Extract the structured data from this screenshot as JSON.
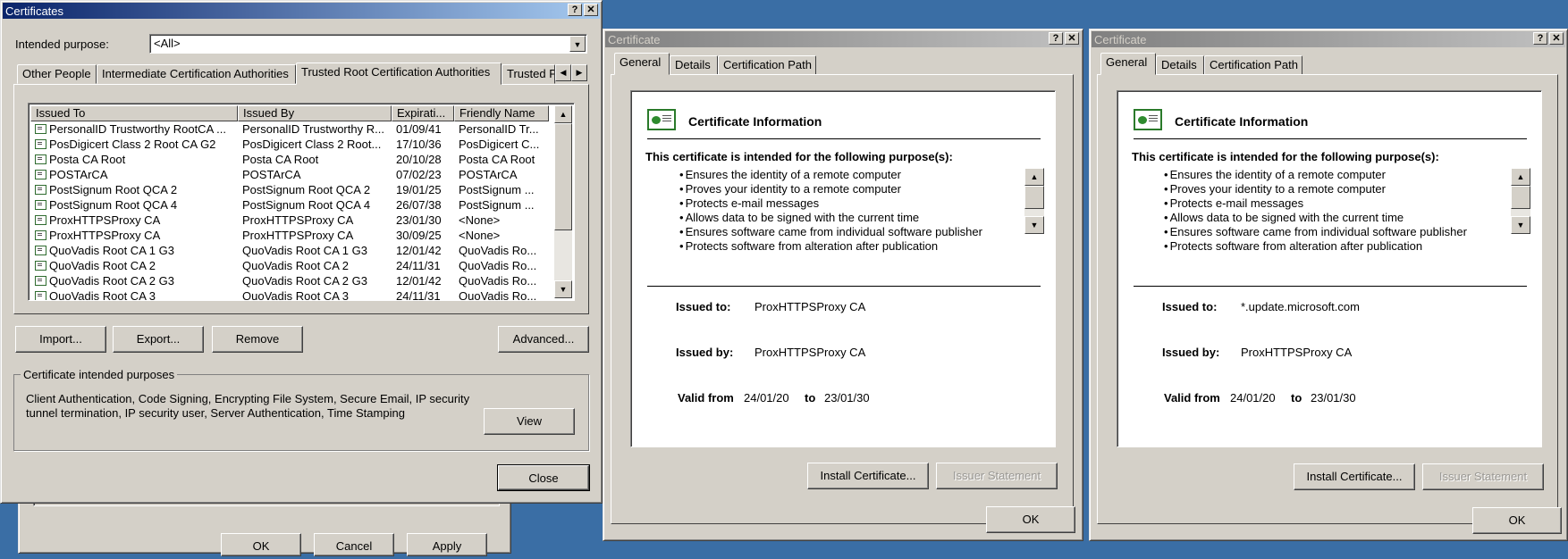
{
  "certificates_window": {
    "title": "Certificates",
    "help_btn": "?",
    "close_btn": "✕",
    "intended_purpose_label": "Intended purpose:",
    "intended_purpose_value": "<All>",
    "tabs": [
      "Other People",
      "Intermediate Certification Authorities",
      "Trusted Root Certification Authorities",
      "Trusted P"
    ],
    "columns": [
      "Issued To",
      "Issued By",
      "Expirati...",
      "Friendly Name"
    ],
    "rows": [
      {
        "to": "PersonalID Trustworthy RootCA ...",
        "by": "PersonalID Trustworthy R...",
        "exp": "01/09/41",
        "name": "PersonalID Tr..."
      },
      {
        "to": "PosDigicert Class 2 Root CA G2",
        "by": "PosDigicert Class 2 Root...",
        "exp": "17/10/36",
        "name": "PosDigicert C..."
      },
      {
        "to": "Posta CA Root",
        "by": "Posta CA Root",
        "exp": "20/10/28",
        "name": "Posta CA Root"
      },
      {
        "to": "POSTArCA",
        "by": "POSTArCA",
        "exp": "07/02/23",
        "name": "POSTArCA"
      },
      {
        "to": "PostSignum Root QCA 2",
        "by": "PostSignum Root QCA 2",
        "exp": "19/01/25",
        "name": "PostSignum ..."
      },
      {
        "to": "PostSignum Root QCA 4",
        "by": "PostSignum Root QCA 4",
        "exp": "26/07/38",
        "name": "PostSignum ..."
      },
      {
        "to": "ProxHTTPSProxy CA",
        "by": "ProxHTTPSProxy CA",
        "exp": "23/01/30",
        "name": "<None>"
      },
      {
        "to": "ProxHTTPSProxy CA",
        "by": "ProxHTTPSProxy CA",
        "exp": "30/09/25",
        "name": "<None>"
      },
      {
        "to": "QuoVadis Root CA 1 G3",
        "by": "QuoVadis Root CA 1 G3",
        "exp": "12/01/42",
        "name": "QuoVadis Ro..."
      },
      {
        "to": "QuoVadis Root CA 2",
        "by": "QuoVadis Root CA 2",
        "exp": "24/11/31",
        "name": "QuoVadis Ro..."
      },
      {
        "to": "QuoVadis Root CA 2 G3",
        "by": "QuoVadis Root CA 2 G3",
        "exp": "12/01/42",
        "name": "QuoVadis Ro..."
      },
      {
        "to": "QuoVadis Root CA 3",
        "by": "QuoVadis Root CA 3",
        "exp": "24/11/31",
        "name": "QuoVadis Ro..."
      }
    ],
    "buttons": {
      "import": "Import...",
      "export": "Export...",
      "remove": "Remove",
      "advanced": "Advanced...",
      "view": "View",
      "close": "Close"
    },
    "purposes_group_label": "Certificate intended purposes",
    "purposes_text": "Client Authentication, Code Signing, Encrypting File System, Secure Email, IP security tunnel termination, IP security user, Server Authentication, Time Stamping",
    "behind_buttons": [
      "OK",
      "Cancel",
      "Apply"
    ]
  },
  "cert_dialogs": [
    {
      "title": "Certificate",
      "tabs": [
        "General",
        "Details",
        "Certification Path"
      ],
      "info_title": "Certificate Information",
      "purpose_heading": "This certificate is intended for the following purpose(s):",
      "purposes": [
        "Ensures the identity of a remote computer",
        "Proves your identity to a remote computer",
        "Protects e-mail messages",
        "Allows data to be signed with the current time",
        "Ensures software came from individual software publisher",
        "Protects software from alteration after publication"
      ],
      "issued_to_label": "Issued to:",
      "issued_to": "ProxHTTPSProxy CA",
      "issued_by_label": "Issued by:",
      "issued_by": "ProxHTTPSProxy CA",
      "valid_from_label": "Valid from",
      "valid_from": "24/01/20",
      "to_label": "to",
      "valid_to": "23/01/30",
      "install_btn": "Install Certificate...",
      "issuer_btn": "Issuer Statement",
      "ok_btn": "OK"
    },
    {
      "title": "Certificate",
      "tabs": [
        "General",
        "Details",
        "Certification Path"
      ],
      "info_title": "Certificate Information",
      "purpose_heading": "This certificate is intended for the following purpose(s):",
      "purposes": [
        "Ensures the identity of a remote computer",
        "Proves your identity to a remote computer",
        "Protects e-mail messages",
        "Allows data to be signed with the current time",
        "Ensures software came from individual software publisher",
        "Protects software from alteration after publication"
      ],
      "issued_to_label": "Issued to:",
      "issued_to": "*.update.microsoft.com",
      "issued_by_label": "Issued by:",
      "issued_by": "ProxHTTPSProxy CA",
      "valid_from_label": "Valid from",
      "valid_from": "24/01/20",
      "to_label": "to",
      "valid_to": "23/01/30",
      "install_btn": "Install Certificate...",
      "issuer_btn": "Issuer Statement",
      "ok_btn": "OK"
    }
  ]
}
